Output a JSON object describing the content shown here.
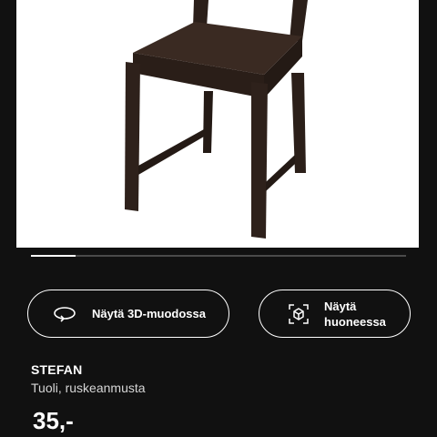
{
  "product_image": {
    "alt": "STEFAN",
    "colors": {
      "background": "#ffffff",
      "wood_dark": "#2b1f19",
      "wood_mid": "#3a2a22",
      "wood_light": "#463328"
    }
  },
  "gallery": {
    "progress_fraction": 0.12
  },
  "actions": {
    "view_3d_label": "Näytä 3D-muodossa",
    "view_3d_icon": "rotate-3d-icon",
    "view_room_label": "Näytä huoneessa",
    "view_room_icon": "ar-cube-icon"
  },
  "product": {
    "name": "STEFAN",
    "description": "Tuoli, ruskeanmusta",
    "price": "35,-"
  }
}
